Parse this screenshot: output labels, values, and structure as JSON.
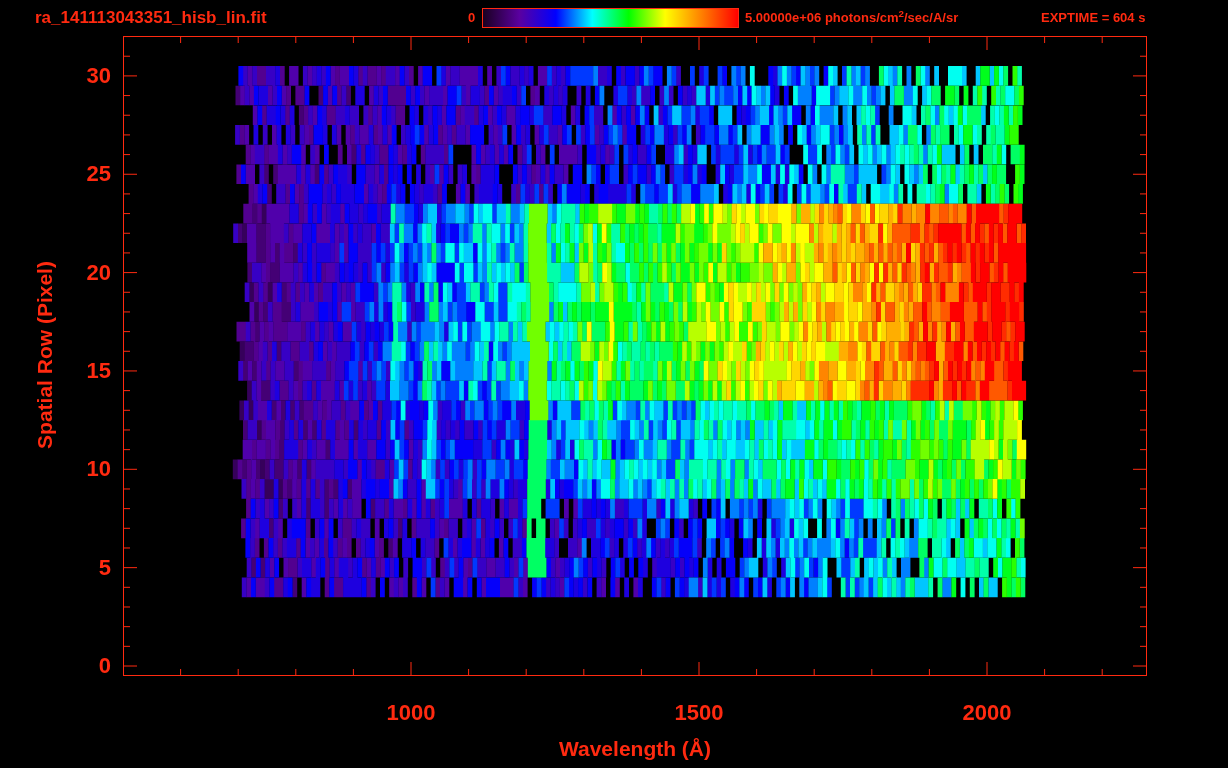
{
  "title": "ra_141113043351_hisb_lin.fit",
  "colorbar": {
    "min_label": "0",
    "max_label": "5.00000e+06 photons/cm$^{2}$/sec/A/sr"
  },
  "exptime": "EXPTIME = 604 s",
  "plot": {
    "xlabel": "Wavelength (Å)",
    "ylabel": "Spatial Row (Pixel)",
    "xticks": [
      "1000",
      "1500",
      "2000"
    ],
    "yticks": [
      "30",
      "25",
      "20",
      "15",
      "10",
      "5",
      "0"
    ]
  }
}
